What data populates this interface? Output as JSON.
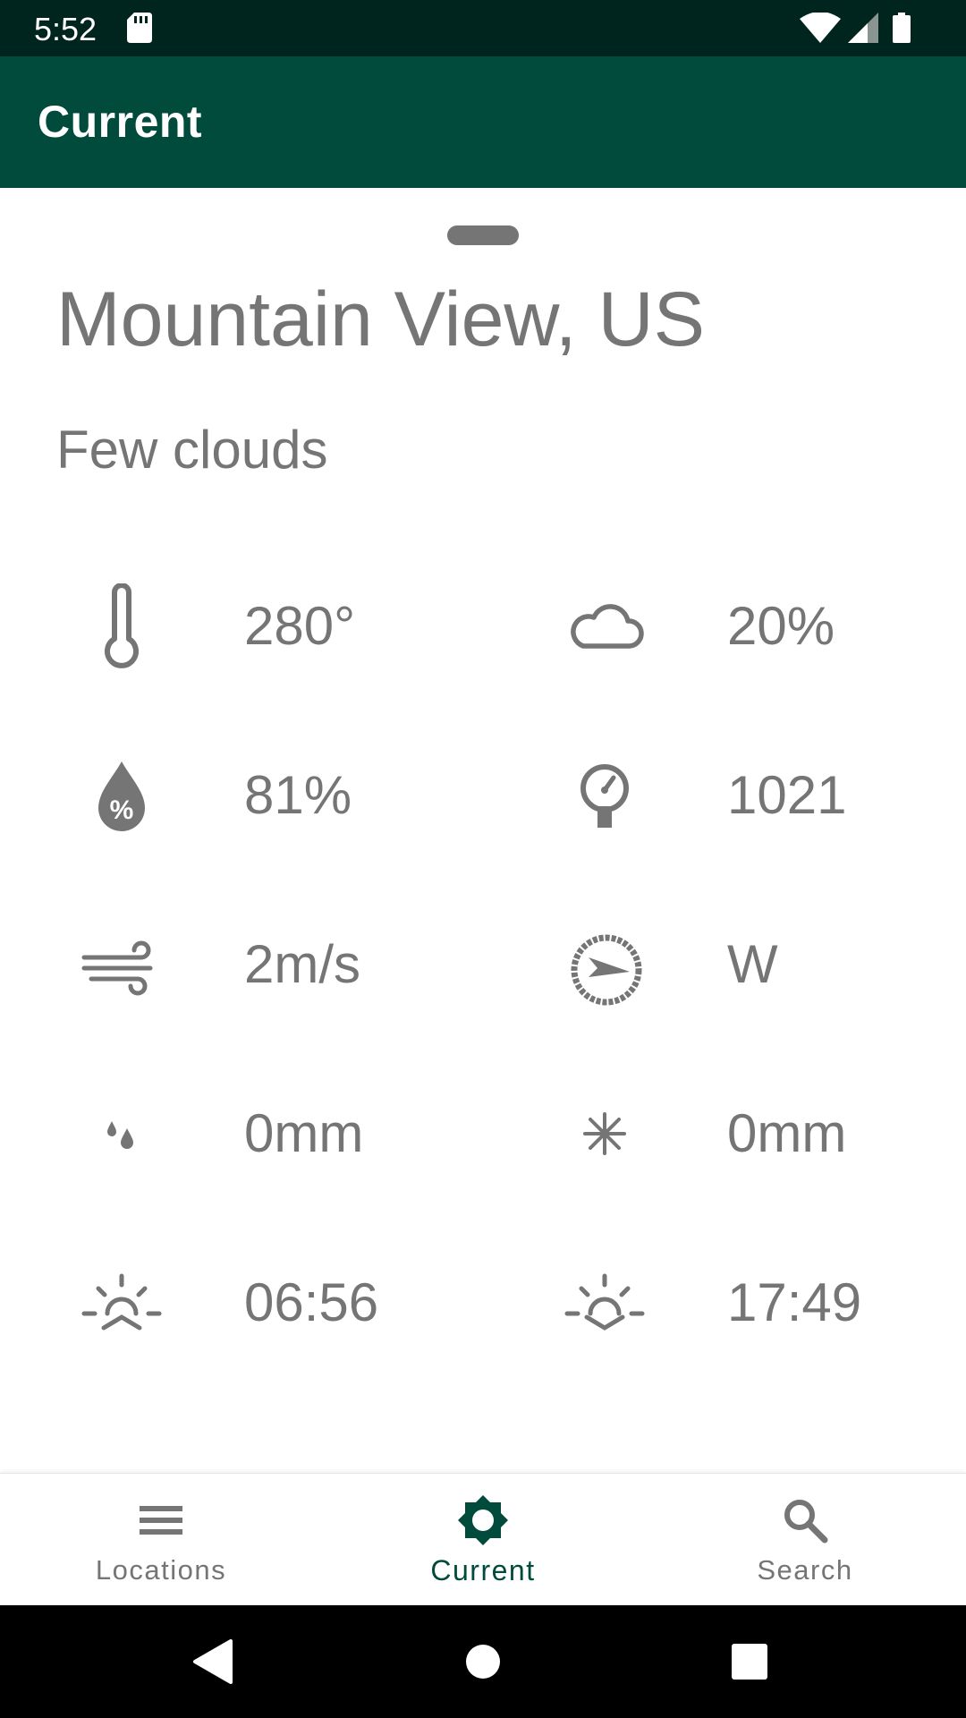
{
  "status_bar": {
    "time": "5:52"
  },
  "app_bar": {
    "title": "Current"
  },
  "location": {
    "city": "Mountain View, US",
    "condition": "Few clouds"
  },
  "metrics": {
    "temperature": "280°",
    "cloudiness": "20%",
    "humidity": "81%",
    "pressure": "1021",
    "wind_speed": "2m/s",
    "wind_direction": "W",
    "rain": "0mm",
    "snow": "0mm",
    "sunrise": "06:56",
    "sunset": "17:49"
  },
  "bottom_nav": {
    "items": [
      {
        "label": "Locations",
        "icon": "list-icon",
        "active": false
      },
      {
        "label": "Current",
        "icon": "sun-gear-icon",
        "active": true
      },
      {
        "label": "Search",
        "icon": "search-icon",
        "active": false
      }
    ]
  },
  "colors": {
    "status_bar": "#00251e",
    "app_bar": "#004b3c",
    "accent": "#004b3c",
    "text_secondary": "#757575"
  }
}
